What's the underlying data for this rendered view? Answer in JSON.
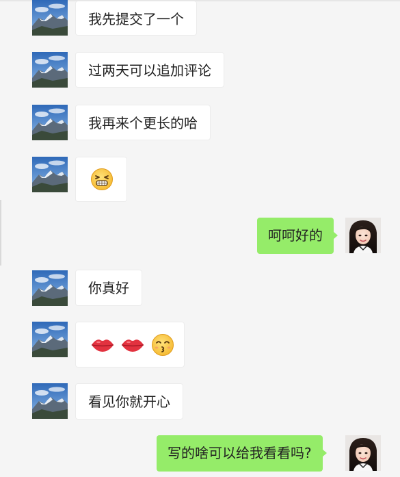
{
  "chat": {
    "messages": [
      {
        "sender": "other",
        "text": "我先提交了一个"
      },
      {
        "sender": "other",
        "text": "过两天可以追加评论"
      },
      {
        "sender": "other",
        "text": "我再来个更长的哈"
      },
      {
        "sender": "other",
        "emoji": [
          "grinning-squint-emoji"
        ]
      },
      {
        "sender": "me",
        "text": "呵呵好的"
      },
      {
        "sender": "other",
        "text": "你真好"
      },
      {
        "sender": "other",
        "emoji": [
          "lips-emoji",
          "lips-emoji",
          "kissing-smiling-eyes-emoji"
        ]
      },
      {
        "sender": "other",
        "text": "看见你就开心"
      },
      {
        "sender": "me",
        "text": "写的啥可以给我看看吗?"
      }
    ]
  },
  "colors": {
    "background": "#f5f5f5",
    "incoming_bubble": "#ffffff",
    "outgoing_bubble": "#95ec69"
  },
  "avatars": {
    "other": "mountain-landscape-avatar",
    "me": "woman-portrait-avatar"
  }
}
